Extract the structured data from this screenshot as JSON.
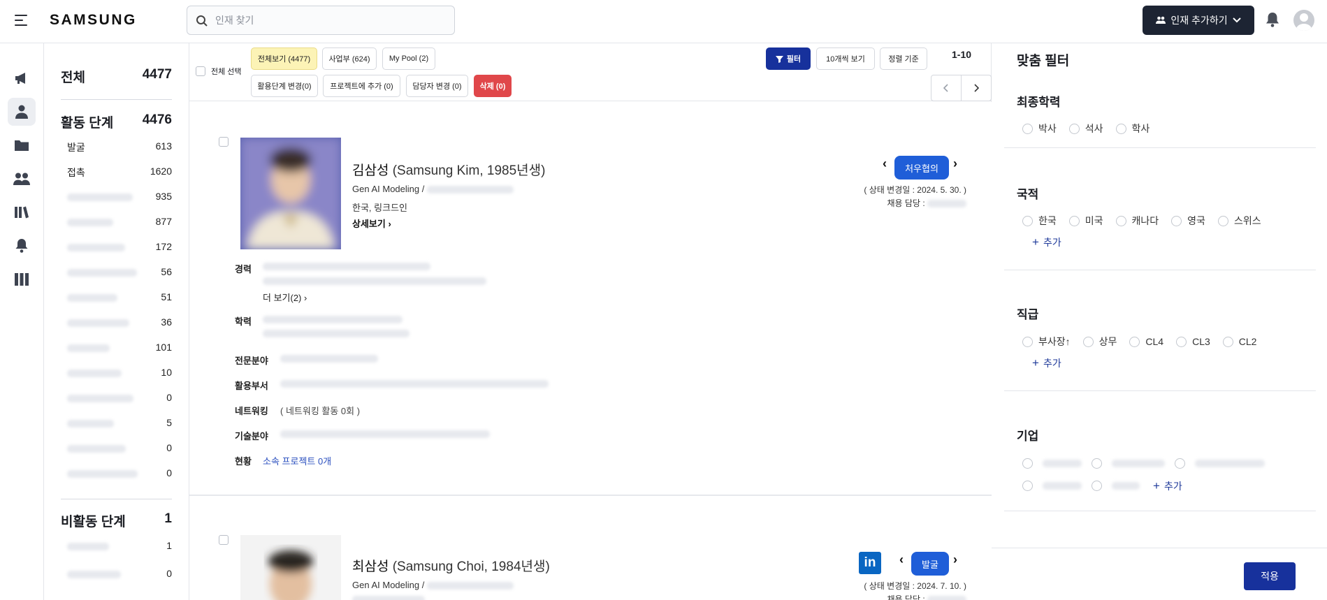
{
  "header": {
    "logo": "SAMSUNG",
    "search_placeholder": "인재 찾기",
    "add_talent_label": "인재 추가하기"
  },
  "stats": {
    "total_label": "전체",
    "total_count": "4477",
    "active_label": "활동 단계",
    "active_count": "4476",
    "active_items": [
      {
        "label": "발굴",
        "count": "613"
      },
      {
        "label": "접촉",
        "count": "1620"
      },
      {
        "label": "",
        "count": "935"
      },
      {
        "label": "",
        "count": "877"
      },
      {
        "label": "",
        "count": "172"
      },
      {
        "label": "",
        "count": "56"
      },
      {
        "label": "",
        "count": "51"
      },
      {
        "label": "",
        "count": "36"
      },
      {
        "label": "",
        "count": "101"
      },
      {
        "label": "",
        "count": "10"
      },
      {
        "label": "",
        "count": "0"
      },
      {
        "label": "",
        "count": "5"
      },
      {
        "label": "",
        "count": "0"
      },
      {
        "label": "",
        "count": "0"
      }
    ],
    "inactive_label": "비활동 단계",
    "inactive_count": "1",
    "inactive_items": [
      {
        "label": "",
        "count": "1"
      },
      {
        "label": "",
        "count": "0"
      }
    ]
  },
  "toolbar": {
    "select_all": "전체 선택",
    "view_all": "전체보기 (4477)",
    "division": "사업부 (624)",
    "my_pool": "My Pool (2)",
    "change_stage": "활용단계 변경(0)",
    "add_to_project": "프로젝트에 추가 (0)",
    "change_manager": "담당자 변경 (0)",
    "delete": "삭제 (0)",
    "filter": "필터",
    "per_page": "10개씩 보기",
    "sort": "정렬 기준",
    "range": "1-10"
  },
  "candidates": [
    {
      "name": "김삼성",
      "name_en": "(Samsung Kim, 1985년생)",
      "role": "Gen AI Modeling /",
      "location": "한국, 링크드인",
      "detail_link": "상세보기 ›",
      "status": "처우협의",
      "status_date": "( 상태 변경일 : 2024. 5. 30. )",
      "manager_label": "채용 담당 :",
      "career_label": "경력",
      "career_more": "더 보기(2) ›",
      "education_label": "학력",
      "expertise_label": "전문분야",
      "dept_label": "활용부서",
      "networking_label": "네트워킹",
      "networking_value": "( 네트워킹 활동 0회 )",
      "tech_label": "기술분야",
      "status_label": "현황",
      "project_value": "소속 프로젝트 0개"
    },
    {
      "name": "최삼성",
      "name_en": "(Samsung Choi, 1984년생)",
      "role": "Gen AI Modeling /",
      "status": "발굴",
      "status_date": "( 상태 변경일 : 2024. 7. 10. )",
      "manager_label": "채용 담당 :",
      "linkedin": "in"
    }
  ],
  "filters": {
    "title": "맞춤 필터",
    "education": {
      "title": "최종학력",
      "options": [
        "박사",
        "석사",
        "학사"
      ]
    },
    "nationality": {
      "title": "국적",
      "options": [
        "한국",
        "미국",
        "캐나다",
        "영국",
        "스위스"
      ],
      "add": "추가"
    },
    "position": {
      "title": "직급",
      "options": [
        "부사장↑",
        "상무",
        "CL4",
        "CL3",
        "CL2"
      ],
      "add": "추가"
    },
    "company": {
      "title": "기업",
      "add": "추가"
    },
    "apply": "적용"
  },
  "colors": {
    "navy": "#17319c",
    "dark": "#1d2433",
    "status_blue": "#1f5ed8",
    "delete_red": "#e0474a",
    "highlight_yellow": "#fcf3b6"
  }
}
